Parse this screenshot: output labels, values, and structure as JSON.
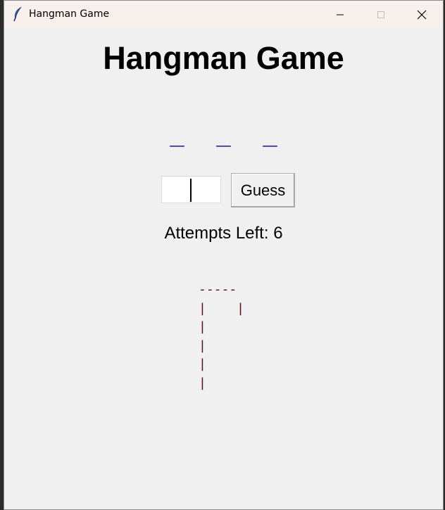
{
  "window": {
    "title": "Hangman Game",
    "icon": "feather-icon"
  },
  "main": {
    "title": "Hangman Game",
    "word_display": "_ _ _",
    "input_value": "",
    "guess_button_label": "Guess",
    "attempts_label": "Attempts Left: 6",
    "gallows_art": "-----\n|    |\n|\n|\n|\n|"
  },
  "colors": {
    "word": "#00008b",
    "gallows": "#5a1010",
    "background": "#f0f0f0",
    "titlebar": "#f7f0ec"
  }
}
